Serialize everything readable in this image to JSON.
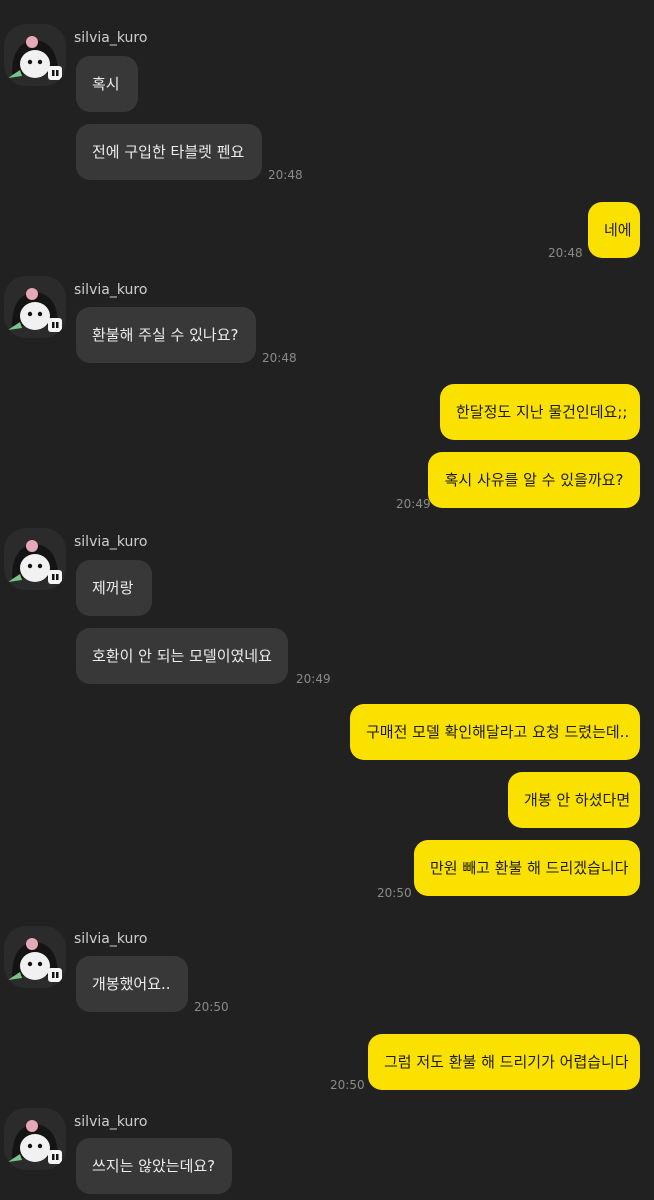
{
  "chat": {
    "sender_name": "silvia_kuro",
    "colors": {
      "background": "#212121",
      "incoming_bubble": "#383838",
      "outgoing_bubble": "#fae100"
    },
    "groups": [
      {
        "sender": "silvia_kuro",
        "messages": [
          "혹시",
          "전에 구입한 타블렛 펜요"
        ],
        "time": "20:48"
      },
      {
        "sender": "me",
        "messages": [
          "네에"
        ],
        "time": "20:48"
      },
      {
        "sender": "silvia_kuro",
        "messages": [
          "환불해 주실 수 있나요?"
        ],
        "time": "20:48"
      },
      {
        "sender": "me",
        "messages": [
          "한달정도 지난 물건인데요;;",
          "혹시 사유를 알 수 있을까요?"
        ],
        "time": "20:49"
      },
      {
        "sender": "silvia_kuro",
        "messages": [
          "제꺼랑",
          "호환이 안 되는 모델이였네요"
        ],
        "time": "20:49"
      },
      {
        "sender": "me",
        "messages": [
          "구매전 모델 확인해달라고 요청 드렸는데..",
          "개봉 안 하셨다면",
          "만원 빼고 환불 해 드리겠습니다"
        ],
        "time": "20:50"
      },
      {
        "sender": "silvia_kuro",
        "messages": [
          "개봉했어요.."
        ],
        "time": "20:50"
      },
      {
        "sender": "me",
        "messages": [
          "그럼 저도 환불 해 드리기가 어렵습니다"
        ],
        "time": "20:50"
      },
      {
        "sender": "silvia_kuro",
        "messages": [
          "쓰지는 않았는데요?"
        ],
        "time": ""
      }
    ]
  }
}
